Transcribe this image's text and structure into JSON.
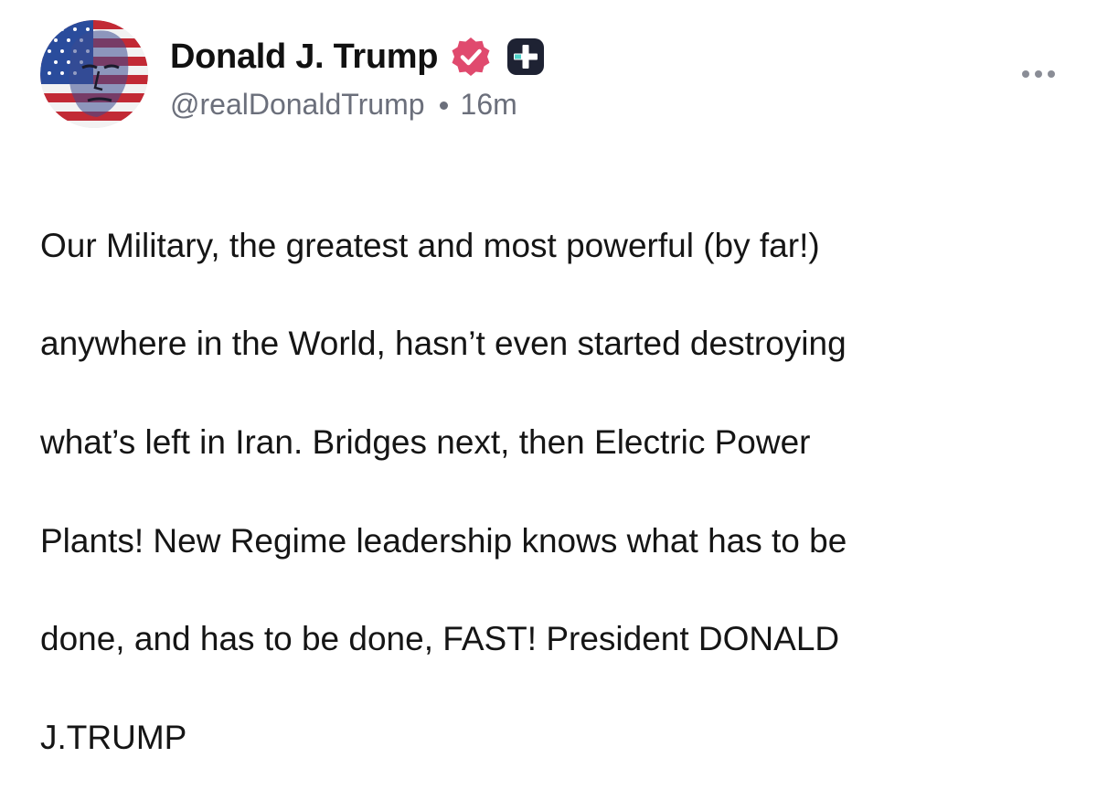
{
  "post": {
    "author": {
      "display_name": "Donald J. Trump",
      "handle": "@realDonaldTrump",
      "verified_icon": "verified-badge-icon",
      "extra_icon": "plus-badge-icon"
    },
    "timestamp": "16m",
    "menu_icon": "more-options-icon",
    "body_lines": [
      "Our Military, the greatest and most powerful (by far!)",
      "anywhere in the World, hasn’t even started destroying",
      "what’s left in Iran. Bridges next, then Electric Power",
      "Plants! New Regime leadership knows what has to be",
      "done, and has to be done, FAST! President DONALD",
      "J.TRUMP"
    ]
  },
  "colors": {
    "verified_badge": "#e04a6e",
    "plus_badge": "#1e2233",
    "plus_accent": "#4fd3c9",
    "meta_text": "#6b6f7b"
  }
}
